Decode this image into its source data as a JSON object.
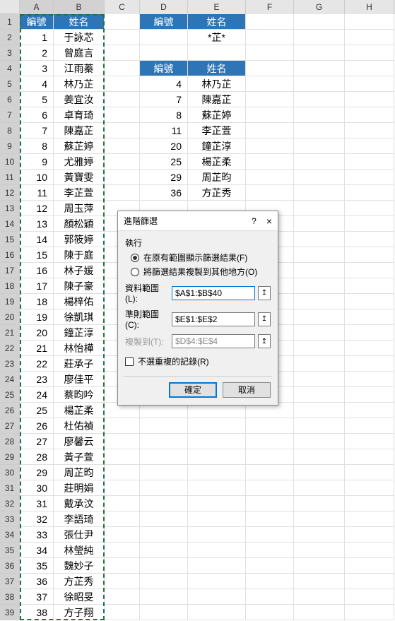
{
  "columns": [
    "A",
    "B",
    "C",
    "D",
    "E",
    "F",
    "G",
    "H"
  ],
  "main_header": {
    "id": "編號",
    "name": "姓名"
  },
  "criteria_header": {
    "id": "編號",
    "name": "姓名"
  },
  "criteria_value": "*芷*",
  "result_header": {
    "id": "編號",
    "name": "姓名"
  },
  "main_rows": [
    {
      "n": "1",
      "name": "于詠芯"
    },
    {
      "n": "2",
      "name": "曾庭言"
    },
    {
      "n": "3",
      "name": "江雨蓁"
    },
    {
      "n": "4",
      "name": "林乃芷"
    },
    {
      "n": "5",
      "name": "姜宜汝"
    },
    {
      "n": "6",
      "name": "卓育琦"
    },
    {
      "n": "7",
      "name": "陳嘉芷"
    },
    {
      "n": "8",
      "name": "蘇芷婷"
    },
    {
      "n": "9",
      "name": "尤雅婷"
    },
    {
      "n": "10",
      "name": "黃寶雯"
    },
    {
      "n": "11",
      "name": "李芷萱"
    },
    {
      "n": "12",
      "name": "周玉萍"
    },
    {
      "n": "13",
      "name": "顏松穎"
    },
    {
      "n": "14",
      "name": "郭筱婷"
    },
    {
      "n": "15",
      "name": "陳于庭"
    },
    {
      "n": "16",
      "name": "林子媛"
    },
    {
      "n": "17",
      "name": "陳子豪"
    },
    {
      "n": "18",
      "name": "楊梓佑"
    },
    {
      "n": "19",
      "name": "徐凱琪"
    },
    {
      "n": "20",
      "name": "鐘芷淳"
    },
    {
      "n": "21",
      "name": "林怡樺"
    },
    {
      "n": "22",
      "name": "莊承子"
    },
    {
      "n": "23",
      "name": "廖佳平"
    },
    {
      "n": "24",
      "name": "蔡昀吟"
    },
    {
      "n": "25",
      "name": "楊芷柔"
    },
    {
      "n": "26",
      "name": "杜佑禎"
    },
    {
      "n": "27",
      "name": "廖馨云"
    },
    {
      "n": "28",
      "name": "黃子萱"
    },
    {
      "n": "29",
      "name": "周芷昀"
    },
    {
      "n": "30",
      "name": "莊明娟"
    },
    {
      "n": "31",
      "name": "戴承汶"
    },
    {
      "n": "32",
      "name": "李語琦"
    },
    {
      "n": "33",
      "name": "張仕尹"
    },
    {
      "n": "34",
      "name": "林瑩純"
    },
    {
      "n": "35",
      "name": "魏妙子"
    },
    {
      "n": "36",
      "name": "方芷秀"
    },
    {
      "n": "37",
      "name": "徐昭旻"
    },
    {
      "n": "38",
      "name": "方子翔"
    }
  ],
  "result_rows": [
    {
      "n": "4",
      "name": "林乃芷"
    },
    {
      "n": "7",
      "name": "陳嘉芷"
    },
    {
      "n": "8",
      "name": "蘇芷婷"
    },
    {
      "n": "11",
      "name": "李芷萱"
    },
    {
      "n": "20",
      "name": "鐘芷淳"
    },
    {
      "n": "25",
      "name": "楊芷柔"
    },
    {
      "n": "29",
      "name": "周芷昀"
    },
    {
      "n": "36",
      "name": "方芷秀"
    }
  ],
  "dialog": {
    "title": "進階篩選",
    "help": "?",
    "close": "×",
    "group": "執行",
    "radio1": "在原有範圍顯示篩選結果(F)",
    "radio2": "將篩選結果複製到其他地方(O)",
    "field1_label": "資料範圍(L):",
    "field1_value": "$A$1:$B$40",
    "field2_label": "準則範圍(C):",
    "field2_value": "$E$1:$E$2",
    "field3_label": "複製到(T):",
    "field3_value": "$D$4:$E$4",
    "checkbox": "不選重複的記錄(R)",
    "ok": "確定",
    "cancel": "取消",
    "collapse": "↥"
  }
}
